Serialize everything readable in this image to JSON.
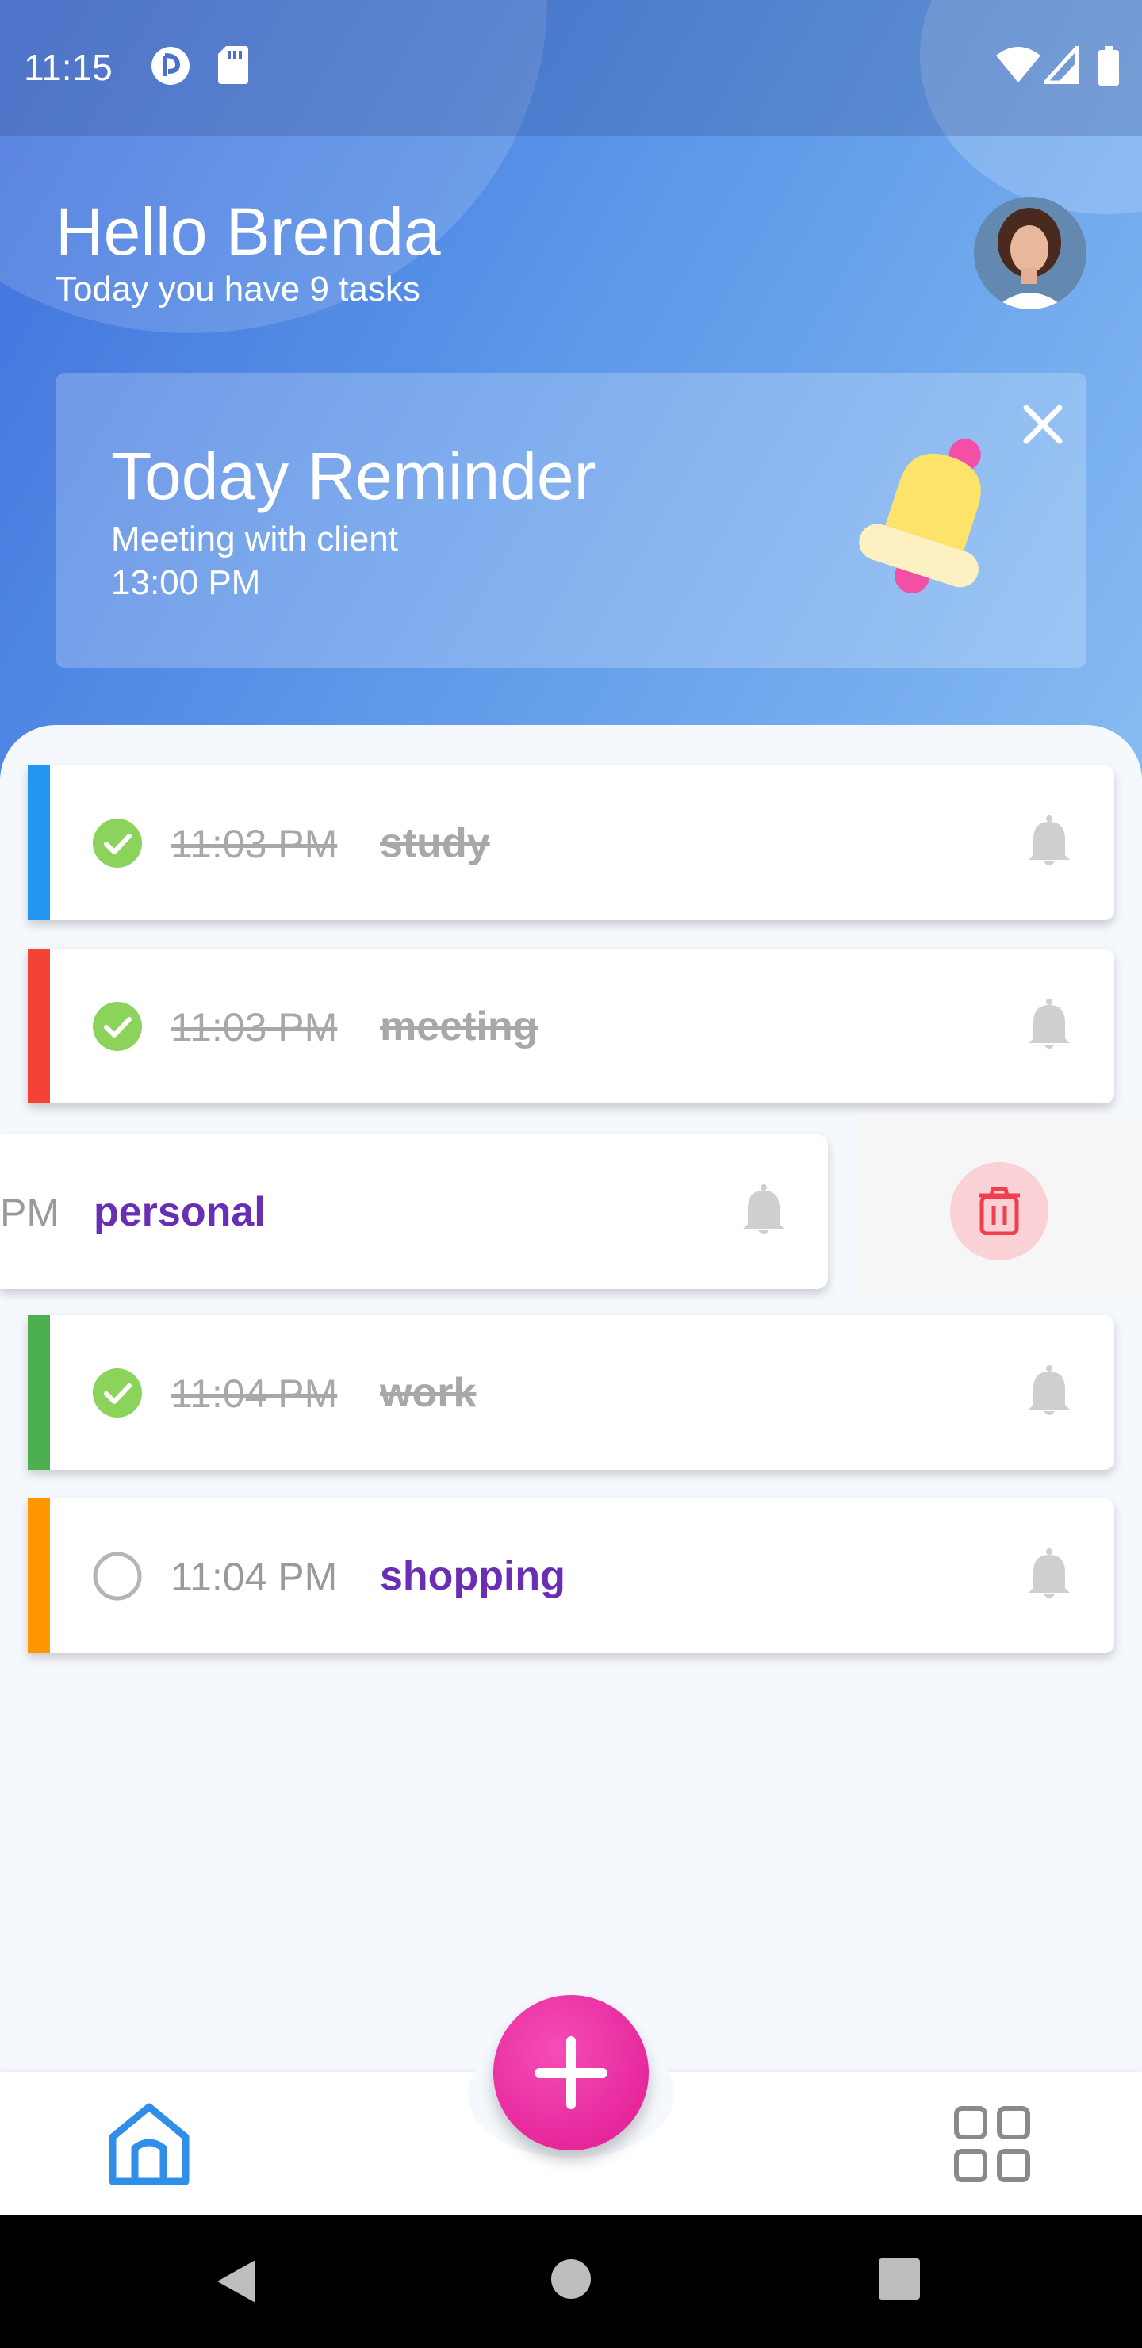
{
  "status_bar": {
    "time": "11:15",
    "icons": [
      "app-notification-icon",
      "sd-card-icon",
      "wifi-icon",
      "cellular-signal-icon",
      "battery-icon"
    ]
  },
  "header": {
    "greeting": "Hello Brenda",
    "subtitle": "Today you have 9 tasks"
  },
  "reminder": {
    "title": "Today Reminder",
    "line1": "Meeting with client",
    "line2": "13:00 PM"
  },
  "tasks": [
    {
      "time": "11:03 PM",
      "title": "study",
      "done": true,
      "color": "#2196f3"
    },
    {
      "time": "11:03 PM",
      "title": "meeting",
      "done": true,
      "color": "#f44336"
    },
    {
      "time": "PM",
      "title": "personal",
      "done": false,
      "swiped": true
    },
    {
      "time": "11:04 PM",
      "title": "work",
      "done": true,
      "color": "#4caf50"
    },
    {
      "time": "11:04 PM",
      "title": "shopping",
      "done": false,
      "color": "#ff9800"
    }
  ],
  "colors": {
    "accent_purple": "#6a2eb4",
    "fab_pink": "#e91e9c",
    "check_green": "#8bd35a",
    "home_blue": "#2f8fe8"
  },
  "nav": {
    "items": [
      "home-icon",
      "add-icon",
      "grid-icon"
    ]
  },
  "system_nav": [
    "back-icon",
    "home-circle-icon",
    "recents-icon"
  ]
}
